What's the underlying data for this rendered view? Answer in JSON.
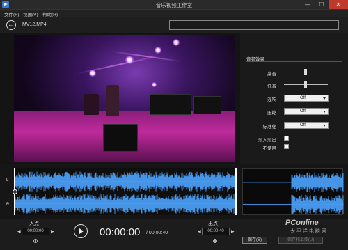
{
  "window": {
    "title": "音乐视频工作室",
    "min": "—",
    "max": "☐",
    "close": "✕"
  },
  "menu": [
    "文件(F)",
    "视图(V)",
    "帮助(H)"
  ],
  "nav": {
    "back": "←",
    "file_name": "MV12.MP4",
    "search_value": "",
    "clear": "✕"
  },
  "panel": {
    "title": "音频效果",
    "rows": [
      {
        "label": "高音",
        "type": "slider",
        "level": 0.5
      },
      {
        "label": "低音",
        "type": "slider",
        "level": 0.5
      },
      {
        "label": "混响",
        "type": "select",
        "value": "Off"
      },
      {
        "label": "压缩",
        "type": "select",
        "value": "Off"
      },
      {
        "label": "标准化",
        "type": "select",
        "value": "Off"
      },
      {
        "label": "淡入淡出",
        "type": "checkbox",
        "checked": false
      },
      {
        "label": "不使用",
        "type": "checkbox",
        "checked": false
      }
    ]
  },
  "waveform": {
    "left_channel": "L",
    "right_channel": "R"
  },
  "controls": {
    "in_label": "入点",
    "in_time": "00:00:00",
    "out_label": "出点",
    "out_time": "00:00:40",
    "current_time": "00:00:00",
    "total_time": "/ 00:00:40",
    "save": "保存(S)",
    "save_upload": "保存和上传(U)",
    "prev": "◀",
    "next": "▶"
  },
  "watermark": {
    "main": "PConline",
    "sub": "太 平 洋 电 脑 网"
  },
  "colors": {
    "wave": "#4da3ff",
    "accent": "#c02a9c"
  }
}
